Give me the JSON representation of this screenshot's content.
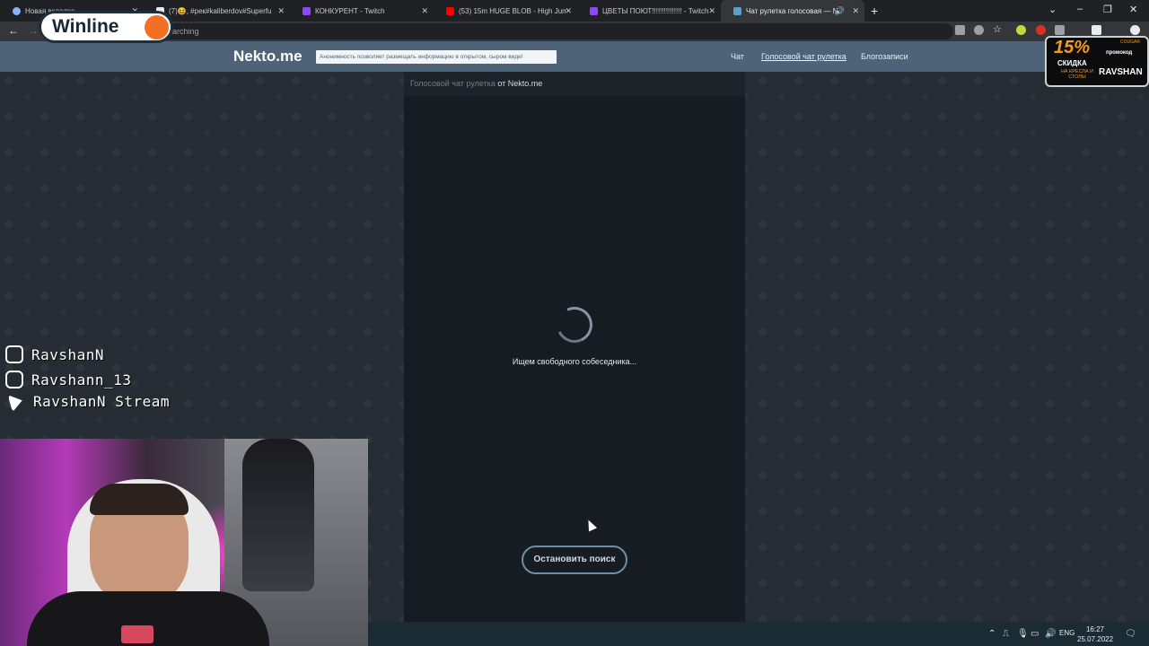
{
  "browser": {
    "tabs": [
      {
        "title": "Новая вкладка",
        "favicon_color": "#8ab4f8",
        "active": false
      },
      {
        "title": "(7)😆, #рек#kaliberdov#Superfu",
        "favicon_color": "#e8eaed",
        "active": false
      },
      {
        "title": "КОНКУРЕНТ - Twitch",
        "favicon_color": "#9146ff",
        "active": false
      },
      {
        "title": "(53) 15m HUGE BLOB - High Jum",
        "favicon_color": "#ff0000",
        "active": false
      },
      {
        "title": "ЦВЕТЫ ПОЮТ!!!!!!!!!!!!!!! - Twitch",
        "favicon_color": "#9146ff",
        "active": false
      },
      {
        "title": "Чат рулетка голосовая — N",
        "favicon_color": "#5aa0c8",
        "active": true
      }
    ],
    "new_tab": "+",
    "address_text": "arching"
  },
  "site": {
    "logo": "Nekto.me",
    "tagline": "Анонимность позволяет размещать информацию в открытом, сыром виде!",
    "nav": [
      {
        "label": "Чат",
        "active": false
      },
      {
        "label": "Голосовой чат рулетка",
        "active": true
      },
      {
        "label": "Блогозаписи",
        "active": false
      }
    ]
  },
  "panel": {
    "breadcrumb_link": "Голосовой чат рулетка",
    "breadcrumb_rest": "от Nekto.me",
    "status": "Ищем свободного собеседника...",
    "stop_button": "Остановить поиск"
  },
  "overlays": {
    "winline": "Winline",
    "promo": {
      "percent": "15%",
      "discount": "СКИДКА",
      "sub": "НА КРЕСЛА И СТОЛЫ",
      "code_label": "промокод",
      "brand": "COUGAR",
      "code": "RAVSHAN"
    },
    "socials": [
      {
        "icon": "twitch-icon",
        "text": "RavshanN"
      },
      {
        "icon": "instagram-icon",
        "text": "Ravshann_13"
      },
      {
        "icon": "telegram-icon",
        "text": "RavshanN Stream"
      }
    ]
  },
  "taskbar": {
    "lang": "ENG",
    "time": "16:27",
    "date": "25.07.2022"
  }
}
